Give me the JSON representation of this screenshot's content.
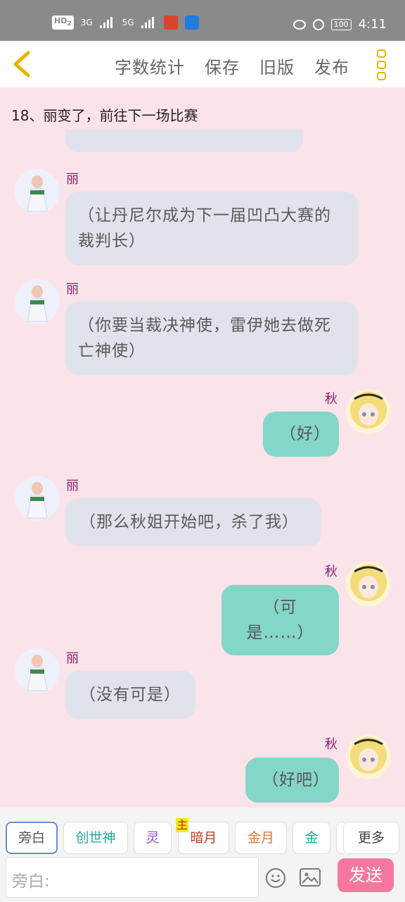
{
  "status_bar": {
    "hd_label": "HD",
    "hd_sub": "2",
    "sim1": "3G",
    "sim2": "5G",
    "battery": "100",
    "time": "4:11"
  },
  "toolbar": {
    "word_count": "字数统计",
    "save": "保存",
    "old_version": "旧版",
    "publish": "发布"
  },
  "chapter_title": "18、丽变了，前往下一场比赛",
  "messages": [
    {
      "side": "left",
      "name": "丽",
      "text": "（让丹尼尔成为下一届凹凸大赛的裁判长）"
    },
    {
      "side": "left",
      "name": "丽",
      "text": "（你要当裁决神使，雷伊她去做死亡神使）"
    },
    {
      "side": "right",
      "name": "秋",
      "text": "（好）"
    },
    {
      "side": "left",
      "name": "丽",
      "text": "（那么秋姐开始吧，杀了我）"
    },
    {
      "side": "right",
      "name": "秋",
      "text": "（可是……）"
    },
    {
      "side": "left",
      "name": "丽",
      "text": "（没有可是）"
    },
    {
      "side": "right",
      "name": "秋",
      "text": "（好吧）"
    }
  ],
  "characters": [
    {
      "label": "旁白",
      "color": "#555555"
    },
    {
      "label": "创世神",
      "color": "#20a99a"
    },
    {
      "label": "灵",
      "color": "#9a4fc7"
    },
    {
      "label": "暗月",
      "color": "#c0402a",
      "tag": "主"
    },
    {
      "label": "金月",
      "color": "#e07b3a"
    },
    {
      "label": "金",
      "color": "#20a99a"
    },
    {
      "label": "更多",
      "color": "#444444"
    }
  ],
  "input": {
    "placeholder": "旁白:",
    "send_label": "发送"
  }
}
